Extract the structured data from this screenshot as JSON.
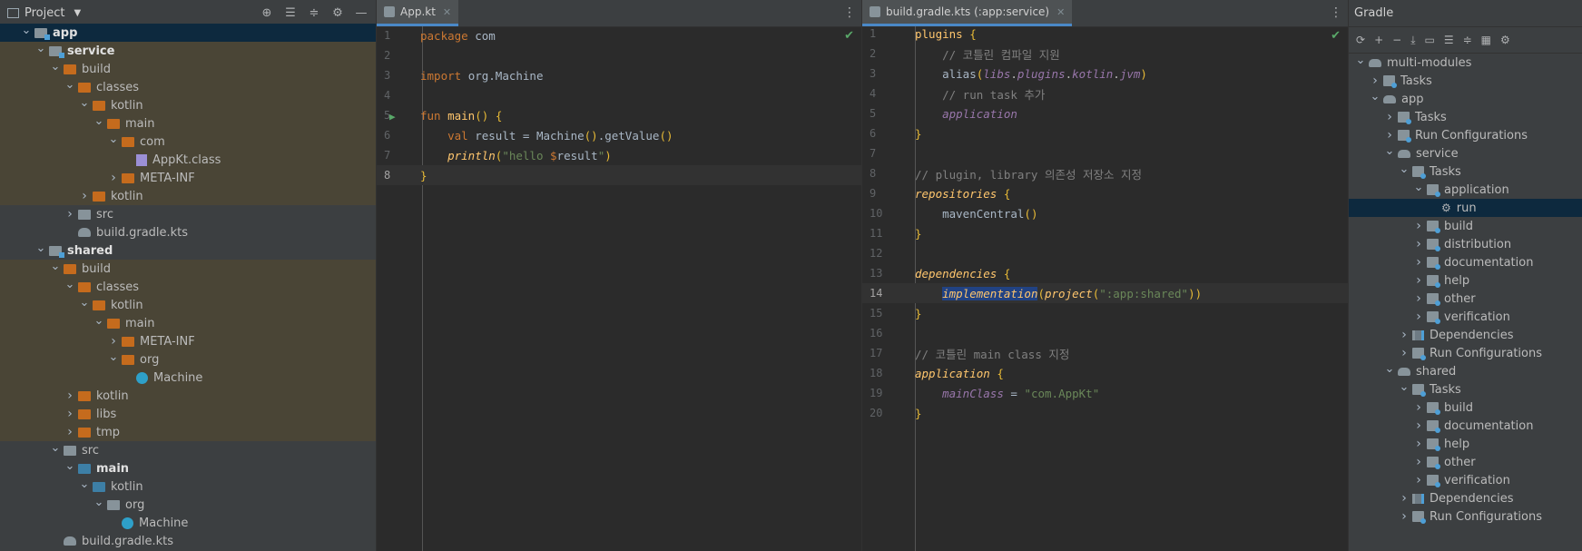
{
  "project": {
    "title": "Project",
    "tree": [
      {
        "indent": 0,
        "arrow": "v",
        "icon": "module",
        "label": "app",
        "bold": true,
        "hl": "sel"
      },
      {
        "indent": 1,
        "arrow": "v",
        "icon": "module",
        "label": "service",
        "bold": true,
        "hl": "hl"
      },
      {
        "indent": 2,
        "arrow": "v",
        "icon": "orange",
        "label": "build",
        "hl": "hl"
      },
      {
        "indent": 3,
        "arrow": "v",
        "icon": "orange",
        "label": "classes",
        "hl": "hl"
      },
      {
        "indent": 4,
        "arrow": "v",
        "icon": "orange",
        "label": "kotlin",
        "hl": "hl"
      },
      {
        "indent": 5,
        "arrow": "v",
        "icon": "orange",
        "label": "main",
        "hl": "hl"
      },
      {
        "indent": 6,
        "arrow": "v",
        "icon": "orange",
        "label": "com",
        "hl": "hl"
      },
      {
        "indent": 7,
        "arrow": "",
        "icon": "class",
        "label": "AppKt.class",
        "hl": "hl"
      },
      {
        "indent": 6,
        "arrow": ">",
        "icon": "orange",
        "label": "META-INF",
        "hl": "hl"
      },
      {
        "indent": 4,
        "arrow": ">",
        "icon": "orange",
        "label": "kotlin",
        "hl": "hl"
      },
      {
        "indent": 3,
        "arrow": ">",
        "icon": "grey",
        "label": "src",
        "hl": ""
      },
      {
        "indent": 3,
        "arrow": "",
        "icon": "gradle",
        "label": "build.gradle.kts",
        "hl": ""
      },
      {
        "indent": 1,
        "arrow": "v",
        "icon": "module",
        "label": "shared",
        "bold": true,
        "hl": ""
      },
      {
        "indent": 2,
        "arrow": "v",
        "icon": "orange",
        "label": "build",
        "hl": "hl"
      },
      {
        "indent": 3,
        "arrow": "v",
        "icon": "orange",
        "label": "classes",
        "hl": "hl"
      },
      {
        "indent": 4,
        "arrow": "v",
        "icon": "orange",
        "label": "kotlin",
        "hl": "hl"
      },
      {
        "indent": 5,
        "arrow": "v",
        "icon": "orange",
        "label": "main",
        "hl": "hl"
      },
      {
        "indent": 6,
        "arrow": ">",
        "icon": "orange",
        "label": "META-INF",
        "hl": "hl"
      },
      {
        "indent": 6,
        "arrow": "v",
        "icon": "orange",
        "label": "org",
        "hl": "hl"
      },
      {
        "indent": 7,
        "arrow": "",
        "icon": "kt",
        "label": "Machine",
        "hl": "hl"
      },
      {
        "indent": 3,
        "arrow": ">",
        "icon": "orange",
        "label": "kotlin",
        "hl": "hl"
      },
      {
        "indent": 3,
        "arrow": ">",
        "icon": "orange",
        "label": "libs",
        "hl": "hl"
      },
      {
        "indent": 3,
        "arrow": ">",
        "icon": "orange",
        "label": "tmp",
        "hl": "hl"
      },
      {
        "indent": 2,
        "arrow": "v",
        "icon": "grey",
        "label": "src",
        "hl": ""
      },
      {
        "indent": 3,
        "arrow": "v",
        "icon": "blue",
        "label": "main",
        "bold": true,
        "hl": ""
      },
      {
        "indent": 4,
        "arrow": "v",
        "icon": "blue",
        "label": "kotlin",
        "hl": ""
      },
      {
        "indent": 5,
        "arrow": "v",
        "icon": "grey",
        "label": "org",
        "hl": ""
      },
      {
        "indent": 6,
        "arrow": "",
        "icon": "kt",
        "label": "Machine",
        "hl": ""
      },
      {
        "indent": 2,
        "arrow": "",
        "icon": "gradle",
        "label": "build.gradle.kts",
        "hl": ""
      }
    ]
  },
  "editor1": {
    "tab_label": "App.kt",
    "lines": [
      {
        "n": "1",
        "html": "<span class='k'>package</span> <span class='ident'>com</span>"
      },
      {
        "n": "2",
        "html": ""
      },
      {
        "n": "3",
        "html": "<span class='k'>import</span> <span class='ident'>org.Machine</span>"
      },
      {
        "n": "4",
        "html": ""
      },
      {
        "n": "5",
        "html": "<span class='k'>fun</span> <span class='fn'>main</span><span class='br'>()</span> <span class='br'>{</span>",
        "run": true
      },
      {
        "n": "6",
        "html": "    <span class='k'>val</span> <span class='ident'>result = Machine</span><span class='br'>()</span><span class='ident'>.getValue</span><span class='br'>()</span>"
      },
      {
        "n": "7",
        "html": "    <span class='ital-fn'>println</span><span class='br'>(</span><span class='s'>\"hello </span><span class='k'>$</span><span class='ident'>result</span><span class='s'>\"</span><span class='br'>)</span>"
      },
      {
        "n": "8",
        "html": "<span class='br'>}</span>",
        "cur": true
      }
    ]
  },
  "editor2": {
    "tab_label": "build.gradle.kts (:app:service)",
    "lines": [
      {
        "n": "1",
        "html": "<span class='fn'>plugins</span> <span class='br'>{</span>"
      },
      {
        "n": "2",
        "html": "    <span class='c'>// 코틀린 컴파일 지원</span>"
      },
      {
        "n": "3",
        "html": "    <span class='ident'>alias</span><span class='br'>(</span><span class='pur'>libs</span>.<span class='pur'>plugins</span>.<span class='pur'>kotlin</span>.<span class='pur'>jvm</span><span class='br'>)</span>"
      },
      {
        "n": "4",
        "html": "    <span class='c'>// run task 추가</span>"
      },
      {
        "n": "5",
        "html": "    <span class='pur'>application</span>"
      },
      {
        "n": "6",
        "html": "<span class='br'>}</span>"
      },
      {
        "n": "7",
        "html": ""
      },
      {
        "n": "8",
        "html": "<span class='c'>// plugin, library 의존성 저장소 지정</span>"
      },
      {
        "n": "9",
        "html": "<span class='ital-fn'>repositories</span> <span class='br'>{</span>"
      },
      {
        "n": "10",
        "html": "    <span class='ident'>mavenCentral</span><span class='br'>()</span>"
      },
      {
        "n": "11",
        "html": "<span class='br'>}</span>"
      },
      {
        "n": "12",
        "html": ""
      },
      {
        "n": "13",
        "html": "<span class='ital-fn'>dependencies</span> <span class='br'>{</span>"
      },
      {
        "n": "14",
        "html": "    <span class='ital-fn selbg'>implementation</span><span class='br'>(</span><span class='ital-fn'>project</span><span class='br'>(</span><span class='s'>\":app:shared\"</span><span class='br'>))</span>",
        "cur": true
      },
      {
        "n": "15",
        "html": "<span class='br'>}</span>"
      },
      {
        "n": "16",
        "html": ""
      },
      {
        "n": "17",
        "html": "<span class='c'>// 코틀린 main class 지정</span>"
      },
      {
        "n": "18",
        "html": "<span class='ital-fn'>application</span> <span class='br'>{</span>"
      },
      {
        "n": "19",
        "html": "    <span class='pur'>mainClass</span> <span class='ident'>=</span> <span class='s'>\"com.AppKt\"</span>"
      },
      {
        "n": "20",
        "html": "<span class='br'>}</span>"
      }
    ]
  },
  "gradle": {
    "title": "Gradle",
    "tree": [
      {
        "indent": 0,
        "arrow": "v",
        "icon": "elephant",
        "label": "multi-modules"
      },
      {
        "indent": 1,
        "arrow": ">",
        "icon": "task",
        "label": "Tasks"
      },
      {
        "indent": 1,
        "arrow": "v",
        "icon": "elephant",
        "label": "app"
      },
      {
        "indent": 2,
        "arrow": ">",
        "icon": "task",
        "label": "Tasks"
      },
      {
        "indent": 2,
        "arrow": ">",
        "icon": "task",
        "label": "Run Configurations"
      },
      {
        "indent": 2,
        "arrow": "v",
        "icon": "elephant",
        "label": "service"
      },
      {
        "indent": 3,
        "arrow": "v",
        "icon": "task",
        "label": "Tasks"
      },
      {
        "indent": 4,
        "arrow": "v",
        "icon": "task",
        "label": "application"
      },
      {
        "indent": 5,
        "arrow": "",
        "icon": "gear",
        "label": "run",
        "sel": true
      },
      {
        "indent": 4,
        "arrow": ">",
        "icon": "task",
        "label": "build"
      },
      {
        "indent": 4,
        "arrow": ">",
        "icon": "task",
        "label": "distribution"
      },
      {
        "indent": 4,
        "arrow": ">",
        "icon": "task",
        "label": "documentation"
      },
      {
        "indent": 4,
        "arrow": ">",
        "icon": "task",
        "label": "help"
      },
      {
        "indent": 4,
        "arrow": ">",
        "icon": "task",
        "label": "other"
      },
      {
        "indent": 4,
        "arrow": ">",
        "icon": "task",
        "label": "verification"
      },
      {
        "indent": 3,
        "arrow": ">",
        "icon": "dep",
        "label": "Dependencies"
      },
      {
        "indent": 3,
        "arrow": ">",
        "icon": "task",
        "label": "Run Configurations"
      },
      {
        "indent": 2,
        "arrow": "v",
        "icon": "elephant",
        "label": "shared"
      },
      {
        "indent": 3,
        "arrow": "v",
        "icon": "task",
        "label": "Tasks"
      },
      {
        "indent": 4,
        "arrow": ">",
        "icon": "task",
        "label": "build"
      },
      {
        "indent": 4,
        "arrow": ">",
        "icon": "task",
        "label": "documentation"
      },
      {
        "indent": 4,
        "arrow": ">",
        "icon": "task",
        "label": "help"
      },
      {
        "indent": 4,
        "arrow": ">",
        "icon": "task",
        "label": "other"
      },
      {
        "indent": 4,
        "arrow": ">",
        "icon": "task",
        "label": "verification"
      },
      {
        "indent": 3,
        "arrow": ">",
        "icon": "dep",
        "label": "Dependencies"
      },
      {
        "indent": 3,
        "arrow": ">",
        "icon": "task",
        "label": "Run Configurations"
      }
    ]
  }
}
